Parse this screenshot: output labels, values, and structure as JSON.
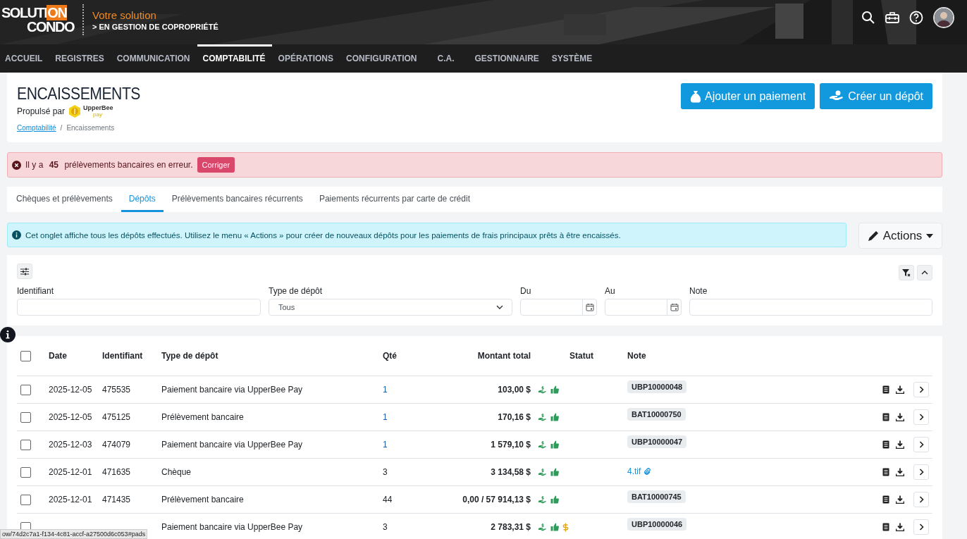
{
  "brand": {
    "logo_top": "SOLUTI",
    "logo_on": "ON",
    "logo_bottom": "CONDO",
    "tagline": "Votre solution",
    "subtitle": "EN GESTION DE COPROPRIÉTÉ",
    "subtitle_mark": ">"
  },
  "nav": [
    {
      "label": "ACCUEIL",
      "selected": false
    },
    {
      "label": "REGISTRES",
      "selected": false
    },
    {
      "label": "COMMUNICATION",
      "selected": false
    },
    {
      "label": "COMPTABILITÉ",
      "selected": true
    },
    {
      "label": "OPÉRATIONS",
      "selected": false
    },
    {
      "label": "CONFIGURATION",
      "selected": false
    },
    {
      "label": "C.A.",
      "selected": false
    },
    {
      "label": "GESTIONNAIRE",
      "selected": false
    },
    {
      "label": "SYSTÈME",
      "selected": false
    }
  ],
  "page": {
    "title": "ENCAISSEMENTS",
    "powered_by": "Propulsé par",
    "partner_name": "UpperBee",
    "partner_sub": "pay",
    "breadcrumb": [
      {
        "label": "Comptabilité",
        "kind": "link"
      },
      {
        "label": "Encaissements",
        "kind": "current"
      }
    ],
    "breadcrumb_separator": "/",
    "buttons": [
      "Ajouter un paiement",
      "Créer un dépôt"
    ]
  },
  "alert": {
    "prefix": "Il y a",
    "count": "45",
    "message": "prélèvements bancaires en erreur.",
    "button": "Corriger"
  },
  "tabs": [
    {
      "label": "Chèques et prélèvements",
      "selected": false
    },
    {
      "label": "Dépôts",
      "selected": true
    },
    {
      "label": "Prélèvements bancaires récurrents",
      "selected": false
    },
    {
      "label": "Paiements récurrents par carte de crédit",
      "selected": false
    }
  ],
  "info": "Cet onglet affiche tous les dépôts effectués. Utilisez le menu « Actions » pour créer de nouveaux dépôts pour les paiements de frais principaux prêts à être encaissés.",
  "actions_button": "Actions",
  "filters": [
    {
      "label": "Identifiant",
      "kind": "text"
    },
    {
      "label": "Type de dépôt",
      "kind": "select",
      "value": "Tous"
    },
    {
      "label": "Du",
      "kind": "date"
    },
    {
      "label": "Au",
      "kind": "date"
    },
    {
      "label": "Note",
      "kind": "text"
    }
  ],
  "table": {
    "select_all_checked": false,
    "columns": [
      "Date",
      "Identifiant",
      "Type de dépôt",
      "Qté",
      "Montant total",
      "Statut",
      "Note"
    ],
    "rows": [
      {
        "checked": false,
        "date": "2025-12-05",
        "id": "475535",
        "type": "Paiement bancaire via UpperBee Pay",
        "qty": "1",
        "qty_link": true,
        "amount": "103,00 $",
        "status": [
          {
            "kind": "deposited"
          },
          {
            "kind": "approved"
          }
        ],
        "note": {
          "text": "UBP10000048",
          "kind": "badge"
        }
      },
      {
        "checked": false,
        "date": "2025-12-05",
        "id": "475125",
        "type": "Prélèvement bancaire",
        "qty": "1",
        "qty_link": true,
        "amount": "170,16 $",
        "status": [
          {
            "kind": "deposited"
          },
          {
            "kind": "approved"
          }
        ],
        "note": {
          "text": "BAT10000750",
          "kind": "badge"
        }
      },
      {
        "checked": false,
        "date": "2025-12-03",
        "id": "474079",
        "type": "Paiement bancaire via UpperBee Pay",
        "qty": "1",
        "qty_link": true,
        "amount": "1 579,10 $",
        "status": [
          {
            "kind": "deposited"
          },
          {
            "kind": "approved"
          }
        ],
        "note": {
          "text": "UBP10000047",
          "kind": "badge"
        }
      },
      {
        "checked": false,
        "date": "2025-12-01",
        "id": "471635",
        "type": "Chèque",
        "qty": "3",
        "qty_link": false,
        "amount": "3 134,58 $",
        "status": [
          {
            "kind": "deposited"
          },
          {
            "kind": "approved"
          }
        ],
        "note": {
          "text": "4.tif",
          "kind": "file"
        }
      },
      {
        "checked": false,
        "date": "2025-12-01",
        "id": "471435",
        "type": "Prélèvement bancaire",
        "qty": "44",
        "qty_link": false,
        "amount": "0,00 / 57 914,13 $",
        "status": [
          {
            "kind": "deposited"
          },
          {
            "kind": "approved"
          }
        ],
        "note": {
          "text": "BAT10000745",
          "kind": "badge"
        }
      },
      {
        "checked": false,
        "date": "",
        "id": "",
        "type": "Paiement bancaire via UpperBee Pay",
        "qty": "3",
        "qty_link": false,
        "amount": "2 783,31 $",
        "status": [
          {
            "kind": "deposited"
          },
          {
            "kind": "approved"
          },
          {
            "kind": "pending"
          }
        ],
        "note": {
          "text": "UBP10000046",
          "kind": "badge"
        }
      }
    ]
  },
  "status_url": "ow/74d2c7a1-f134-4c81-accf-a27500d6c053#pads"
}
